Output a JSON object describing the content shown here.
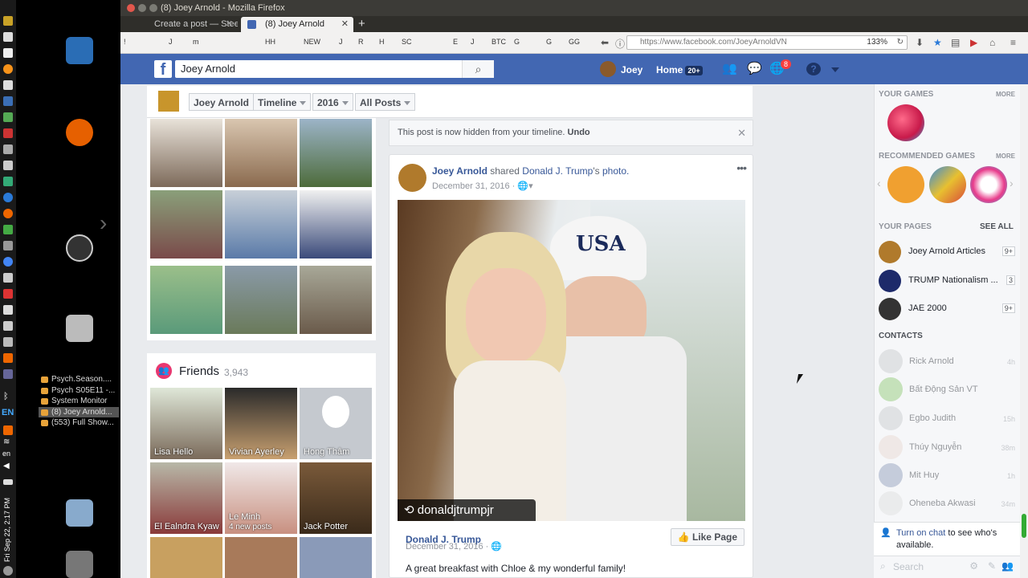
{
  "window": {
    "title": "(8) Joey Arnold - Mozilla Firefox"
  },
  "tabs": [
    {
      "label": "Create a post — Steem"
    },
    {
      "label": "(8) Joey Arnold"
    }
  ],
  "bookmarks": [
    "!",
    "J",
    "m",
    "HH",
    "NEW",
    "J",
    "R",
    "H",
    "SC",
    "E",
    "J",
    "BTC",
    "G",
    "G",
    "GG"
  ],
  "url": "https://www.facebook.com/JoeyArnoldVN",
  "zoom": "133%",
  "window_list": [
    "Psych.Season....",
    "Psych S05E11 -...",
    "System Monitor",
    "(8) Joey Arnold...",
    "(553) Full Show..."
  ],
  "panel": {
    "lang": "EN",
    "keyboard": "en",
    "clock": "Fri Sep 22, 2:17 PM"
  },
  "fb": {
    "logo": "f",
    "search_value": "Joey Arnold",
    "user": "Joey",
    "home": "Home",
    "home_badge": "20+",
    "notif_badge": "8"
  },
  "strip": {
    "name": "Joey Arnold",
    "timeline": "Timeline",
    "year": "2016",
    "filter": "All Posts"
  },
  "friends": {
    "title": "Friends",
    "count": "3,943",
    "items": [
      {
        "name": "Lisa Hello"
      },
      {
        "name": "Vivian Ayerley"
      },
      {
        "name": "Hong Thâm"
      },
      {
        "name": "El Ealndra Kyaw"
      },
      {
        "name": "Le Minh",
        "sub": "4 new posts"
      },
      {
        "name": "Jack Potter"
      }
    ]
  },
  "notice": {
    "text": "This post is now hidden from your timeline.",
    "undo": "Undo"
  },
  "post": {
    "author": "Joey Arnold",
    "shared": "shared",
    "source": "Donald J. Trump",
    "source_suffix": "'s",
    "photo": "photo.",
    "date": "December 31, 2016",
    "photo_tag": "donaldjtrumpjr",
    "hat_text": "USA",
    "sub_author": "Donald J. Trump",
    "sub_date": "December 31, 2016",
    "like_page": "Like Page",
    "caption": "A great breakfast with Chloe & my wonderful family!"
  },
  "right": {
    "your_games": "YOUR GAMES",
    "more1": "MORE",
    "rec_games": "RECOMMENDED GAMES",
    "more2": "MORE",
    "your_pages": "YOUR PAGES",
    "see_all": "SEE ALL",
    "pages": [
      {
        "name": "Joey Arnold Articles",
        "count": "9+"
      },
      {
        "name": "TRUMP Nationalism ...",
        "count": "3"
      },
      {
        "name": "JAE 2000",
        "count": "9+"
      }
    ],
    "contacts_h": "CONTACTS",
    "contacts": [
      {
        "name": "Rick Arnold",
        "time": "4h"
      },
      {
        "name": "Bất Động Sản VT",
        "time": ""
      },
      {
        "name": "Egbo Judith",
        "time": "15h"
      },
      {
        "name": "Thúy Nguyễn",
        "time": "38m"
      },
      {
        "name": "Mit Huy",
        "time": "1h"
      },
      {
        "name": "Oheneba Akwasi",
        "time": "34m"
      }
    ],
    "chat_link": "Turn on chat",
    "chat_text": "to see who's available.",
    "search": "Search"
  }
}
